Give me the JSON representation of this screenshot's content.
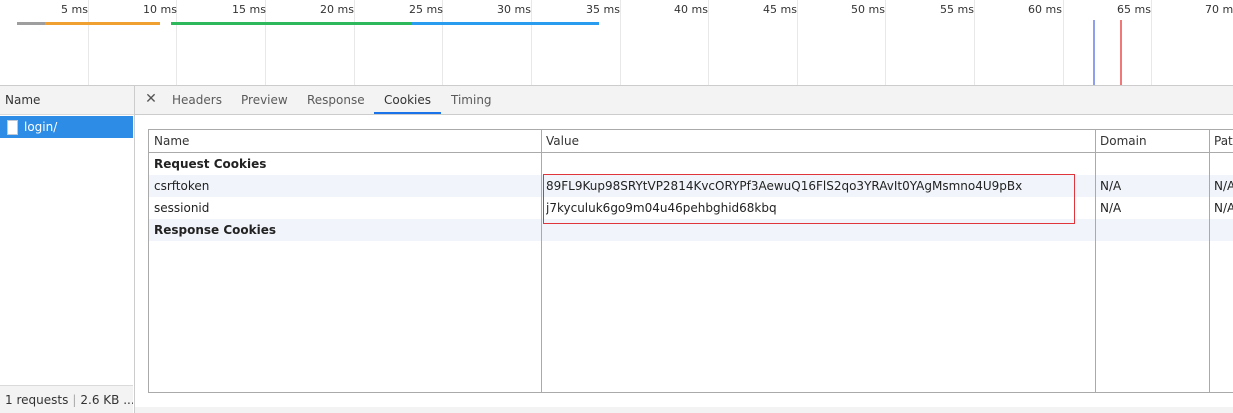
{
  "timeline": {
    "ticks": [
      "5 ms",
      "10 ms",
      "15 ms",
      "20 ms",
      "25 ms",
      "30 ms",
      "35 ms",
      "40 ms",
      "45 ms",
      "50 ms",
      "55 ms",
      "60 ms",
      "65 ms",
      "70 ms"
    ],
    "colors": {
      "stalled": "#9e9e9e",
      "waiting": "#f0a030",
      "download_green": "#2eb85c",
      "download_blue": "#2a9cf0",
      "dom_content_loaded": "#8f9ff0",
      "load": "#f07878"
    }
  },
  "request_list": {
    "column_header": "Name",
    "items": [
      {
        "name": "login/",
        "selected": true
      }
    ],
    "status": {
      "requests": "1 requests",
      "transferred": "2.6 KB ..."
    }
  },
  "detail": {
    "close_icon": "close-icon",
    "tabs": [
      {
        "label": "Headers",
        "active": false
      },
      {
        "label": "Preview",
        "active": false
      },
      {
        "label": "Response",
        "active": false
      },
      {
        "label": "Cookies",
        "active": true
      },
      {
        "label": "Timing",
        "active": false
      }
    ],
    "cookies_table": {
      "columns": [
        "Name",
        "Value",
        "Domain",
        "Pat"
      ],
      "request_cookies_label": "Request Cookies",
      "response_cookies_label": "Response Cookies",
      "rows": [
        {
          "name": "csrftoken",
          "value": "89FL9Kup98SRYtVP2814KvcORYPf3AewuQ16FlS2qo3YRAvIt0YAgMsmno4U9pBx",
          "domain": "N/A",
          "path": "N/A"
        },
        {
          "name": "sessionid",
          "value": "j7kyculuk6go9m04u46pehbghid68kbq",
          "domain": "N/A",
          "path": "N/A"
        }
      ]
    },
    "accent_color": "#1a73e8",
    "highlight_color": "#e0353b"
  }
}
